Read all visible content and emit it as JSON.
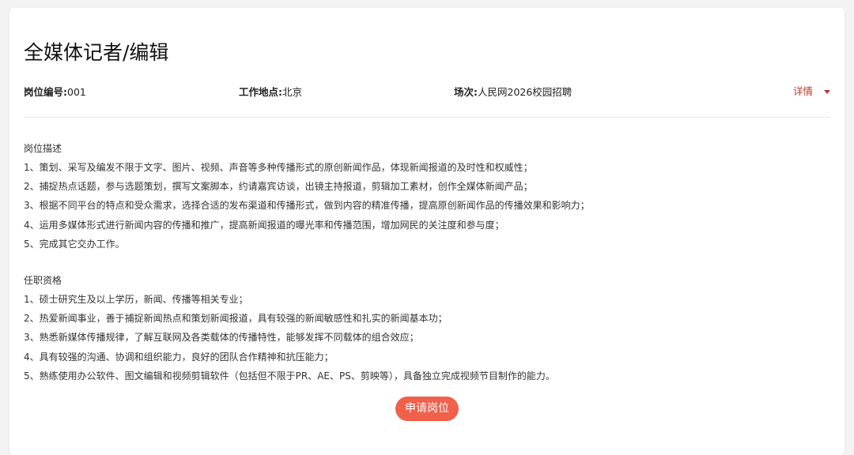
{
  "job": {
    "title": "全媒体记者/编辑",
    "meta": [
      {
        "key": "岗位编号:",
        "value": "001"
      },
      {
        "key": "工作地点:",
        "value": "北京"
      },
      {
        "key": "场次:",
        "value": "人民网2026校园招聘"
      }
    ],
    "detail_label": "详情",
    "apply_label": "申请岗位"
  },
  "description": {
    "heading": "岗位描述",
    "items": [
      "1、策划、采写及编发不限于文字、图片、视频、声音等多种传播形式的原创新闻作品，体现新闻报道的及时性和权威性；",
      "2、捕捉热点话题，参与选题策划，撰写文案脚本，约请嘉宾访谈，出镜主持报道，剪辑加工素材，创作全媒体新闻产品；",
      "3、根据不同平台的特点和受众需求，选择合适的发布渠道和传播形式，做到内容的精准传播，提高原创新闻作品的传播效果和影响力；",
      "4、运用多媒体形式进行新闻内容的传播和推广，提高新闻报道的曝光率和传播范围，增加网民的关注度和参与度；",
      "5、完成其它交办工作。"
    ]
  },
  "qualifications": {
    "heading": "任职资格",
    "items": [
      "1、硕士研究生及以上学历，新闻、传播等相关专业；",
      "2、热爱新闻事业，善于捕捉新闻热点和策划新闻报道，具有较强的新闻敏感性和扎实的新闻基本功；",
      "3、熟悉新媒体传播规律，了解互联网及各类载体的传播特性，能够发挥不同载体的组合效应；",
      "4、具有较强的沟通、协调和组织能力，良好的团队合作精神和抗压能力；",
      "5、熟练使用办公软件、图文编辑和视频剪辑软件（包括但不限于PR、AE、PS、剪映等），具备独立完成视频节目制作的能力。"
    ]
  },
  "colors": {
    "accent": "#c0392b",
    "apply_button": "#f0604b",
    "background": "#f3f3f3",
    "card": "#ffffff"
  },
  "icons": {
    "detail_toggle": "caret-down-icon"
  }
}
